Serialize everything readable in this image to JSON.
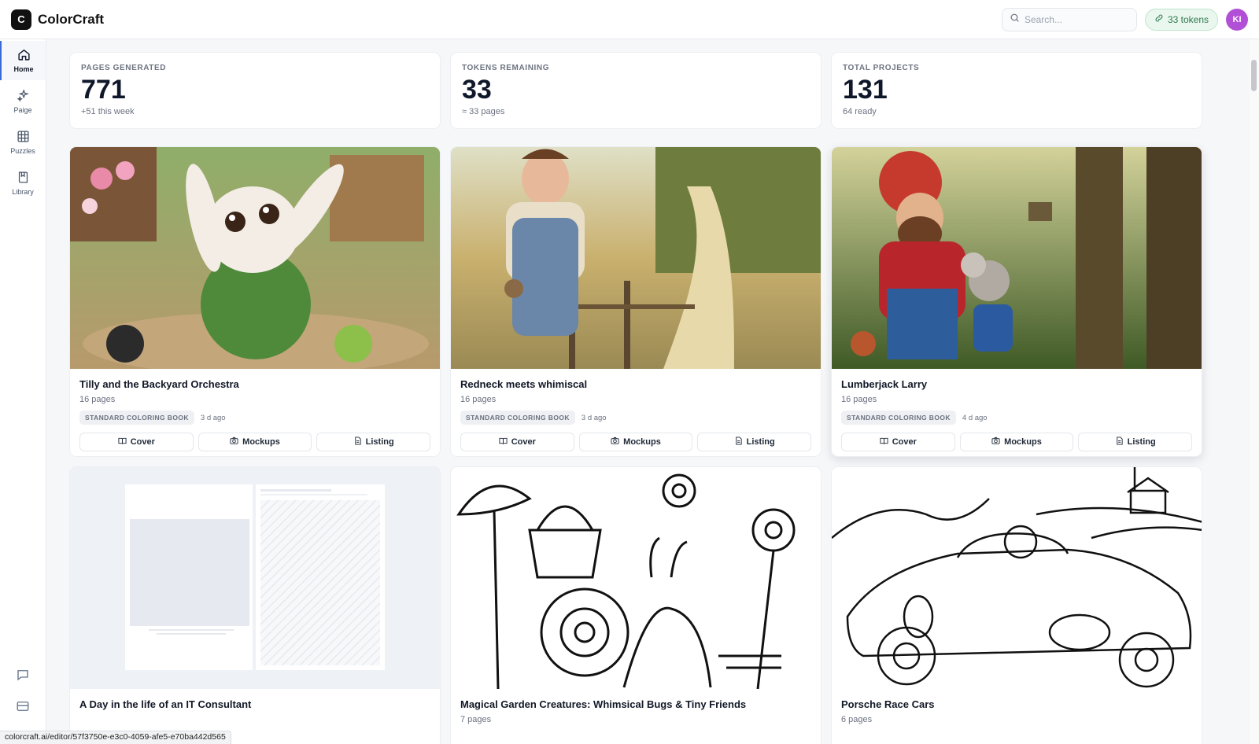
{
  "app": {
    "logo_letter": "C",
    "name": "ColorCraft"
  },
  "header": {
    "search_placeholder": "Search...",
    "tokens": "33 tokens",
    "avatar_initials": "KI"
  },
  "sidebar": {
    "items": [
      {
        "label": "Home",
        "icon": "home-icon",
        "active": true
      },
      {
        "label": "Paige",
        "icon": "sparkles-icon"
      },
      {
        "label": "Puzzles",
        "icon": "grid-icon"
      },
      {
        "label": "Library",
        "icon": "book-icon"
      }
    ],
    "bottom_icons": [
      "chat-icon",
      "panel-icon"
    ]
  },
  "stats": [
    {
      "label": "PAGES GENERATED",
      "value": "771",
      "sub": "+51 this week"
    },
    {
      "label": "TOKENS REMAINING",
      "value": "33",
      "sub": "≈ 33 pages"
    },
    {
      "label": "TOTAL PROJECTS",
      "value": "131",
      "sub": "64 ready"
    }
  ],
  "projects": [
    {
      "title": "Tilly and the Backyard Orchestra",
      "pages": "16 pages",
      "badge": "STANDARD COLORING BOOK",
      "age": "3 d ago",
      "actions": [
        "Cover",
        "Mockups",
        "Listing"
      ]
    },
    {
      "title": "Redneck meets whimiscal",
      "pages": "16 pages",
      "badge": "STANDARD COLORING BOOK",
      "age": "3 d ago",
      "actions": [
        "Cover",
        "Mockups",
        "Listing"
      ]
    },
    {
      "title": "Lumberjack Larry",
      "pages": "16 pages",
      "badge": "STANDARD COLORING BOOK",
      "age": "4 d ago",
      "actions": [
        "Cover",
        "Mockups",
        "Listing"
      ]
    },
    {
      "title": "A Day in the life of an IT Consultant",
      "pages": ""
    },
    {
      "title": "Magical Garden Creatures: Whimsical Bugs & Tiny Friends",
      "pages": "7 pages"
    },
    {
      "title": "Porsche Race Cars",
      "pages": "6 pages"
    }
  ],
  "status_url": "colorcraft.ai/editor/57f3750e-e3c0-4059-afe5-e70ba442d565",
  "colors": {
    "accent": "#3b6ad6",
    "token_green": "#2f7a4d",
    "avatar": "#b14fd6"
  }
}
